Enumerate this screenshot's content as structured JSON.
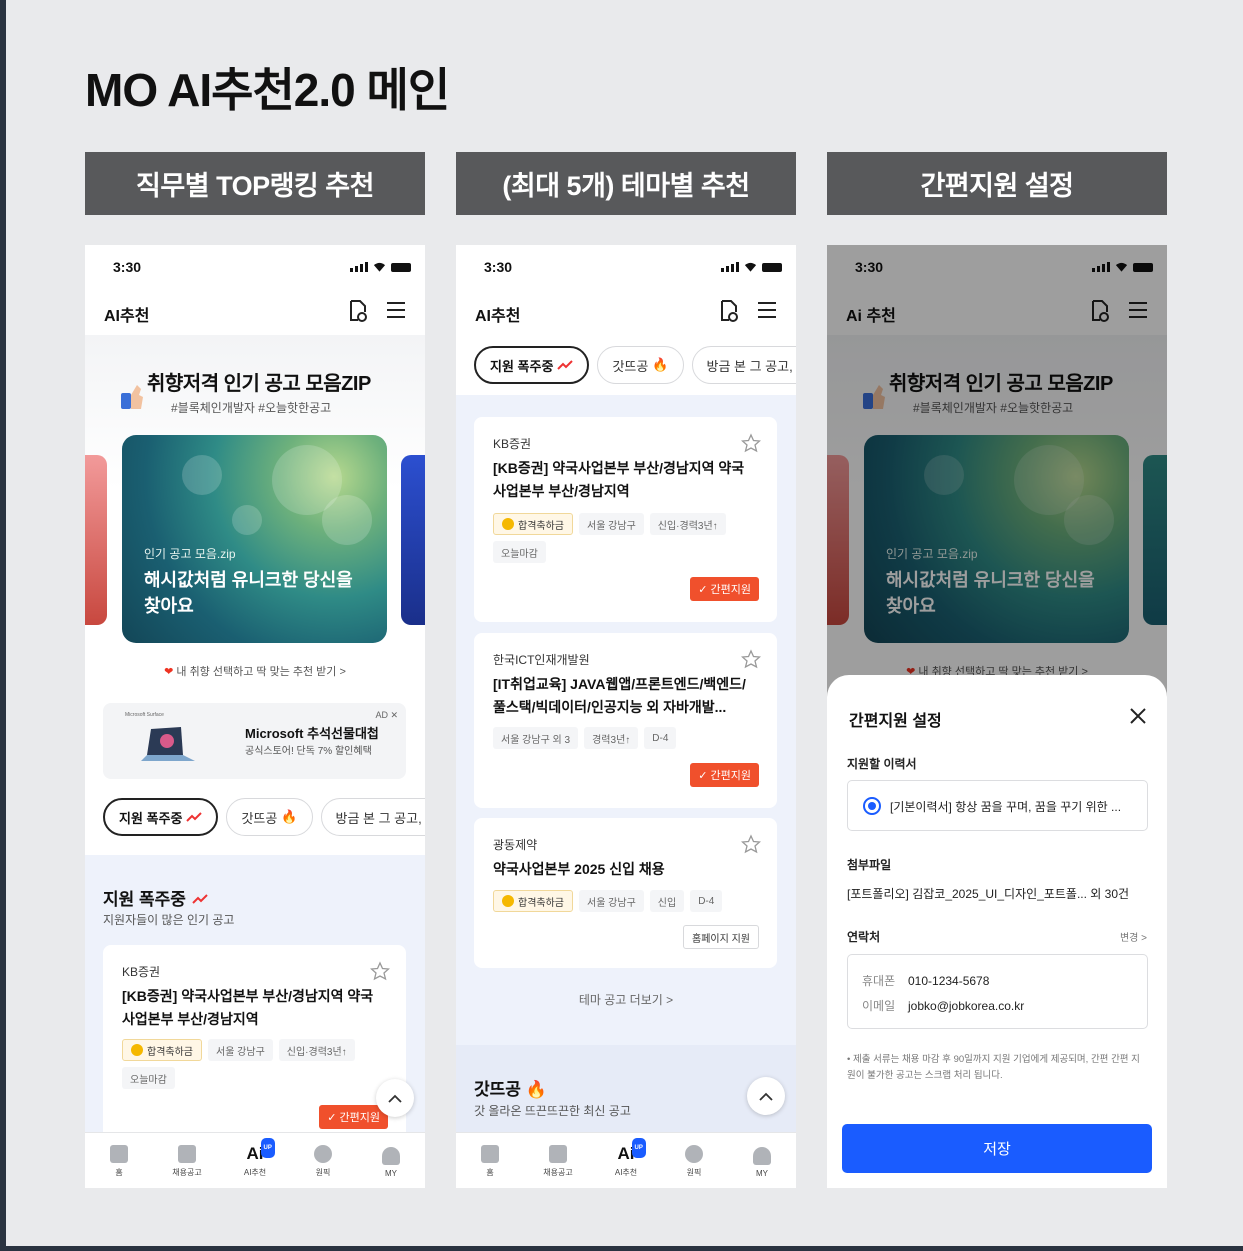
{
  "page_title": "MO AI추천2.0 메인",
  "columns": [
    {
      "header": "직무별  TOP랭킹 추천"
    },
    {
      "header": "(최대 5개) 테마별 추천"
    },
    {
      "header": "간편지원 설정"
    }
  ],
  "status_time": "3:30",
  "appbar": {
    "title_1": "AI추천",
    "title_2": "AI추천",
    "title_3": "Ai 추천"
  },
  "hero": {
    "title": "취향저격 인기 공고 모음ZIP",
    "tags": "#블록체인개발자 #오늘핫한공고",
    "card_sub": "인기 공고 모음.zip",
    "card_title": "해시값처럼 유니크한 당신을 찾아요",
    "hint": "내 취향 선택하고 딱 맞는 추천 받기 >"
  },
  "ad": {
    "brand": "Microsoft Surface",
    "title": "Microsoft 추석선물대첩",
    "desc": "공식스토어! 단독 7% 할인혜택",
    "tag": "AD ✕"
  },
  "chips": [
    "지원 폭주중",
    "갓뜨공",
    "방금 본 그 공고, 담"
  ],
  "section1": {
    "title": "지원 폭주중",
    "sub": "지원자들이 많은 인기 공고"
  },
  "section2": {
    "title": "갓뜨공",
    "sub": "갓 올라온 뜨끈뜨끈한 최신 공고"
  },
  "jobs": [
    {
      "company": "KB증권",
      "title": "[KB증권] 약국사업본부 부산/경남지역 약국사업본부 부산/경남지역",
      "tags": [
        "합격축하금",
        "서울 강남구",
        "신입·경력3년↑",
        "오늘마감"
      ],
      "action": "간편지원"
    },
    {
      "company": "한국ICT인재개발원",
      "title": "[IT취업교육] JAVA웹앱/프론트엔드/백엔드/풀스택/빅데이터/인공지능 외 자바개발...",
      "tags": [
        "서울 강남구 외 3",
        "경력3년↑",
        "D-4"
      ],
      "action": "간편지원"
    },
    {
      "company": "광동제약",
      "title": "약국사업본부 2025 신입 채용",
      "tags": [
        "합격축하금",
        "서울 강남구",
        "신입",
        "D-4"
      ],
      "action": "홈페이지 지원"
    }
  ],
  "more_link": "테마 공고 더보기 >",
  "tabbar": [
    "홈",
    "채용공고",
    "AI추천",
    "원픽",
    "MY"
  ],
  "tab_ai_label": "Ai",
  "tab_badge": "UP",
  "sheet": {
    "title": "간편지원 설정",
    "resume_label": "지원할 이력서",
    "resume_value": "[기본이력서] 항상 꿈을 꾸며, 꿈을 꾸기 위한 ...",
    "file_label": "첨부파일",
    "file_value": "[포트폴리오] 김잡코_2025_UI_디자인_포트폴... 외 30건",
    "contact_label": "연락처",
    "change": "변경 >",
    "phone_key": "휴대폰",
    "phone_val": "010-1234-5678",
    "email_key": "이메일",
    "email_val": "jobko@jobkorea.co.kr",
    "notice": "• 제출 서류는 채용 마감 후 90일까지 지원 기업에게 제공되며, 간편 간편 지원이 불가한 공고는 스크랩 처리 됩니다.",
    "save": "저장"
  },
  "colors": {
    "accent": "#1a5cff",
    "apply": "#f0502c",
    "header_bg": "#58595b",
    "section_bg": "#eef2fb"
  },
  "icons": {
    "bell": "settings-doc-icon",
    "menu": "hamburger-icon",
    "star": "star-outline-icon",
    "close": "close-icon",
    "fire": "fire-emoji",
    "trend": "trend-up-icon"
  }
}
